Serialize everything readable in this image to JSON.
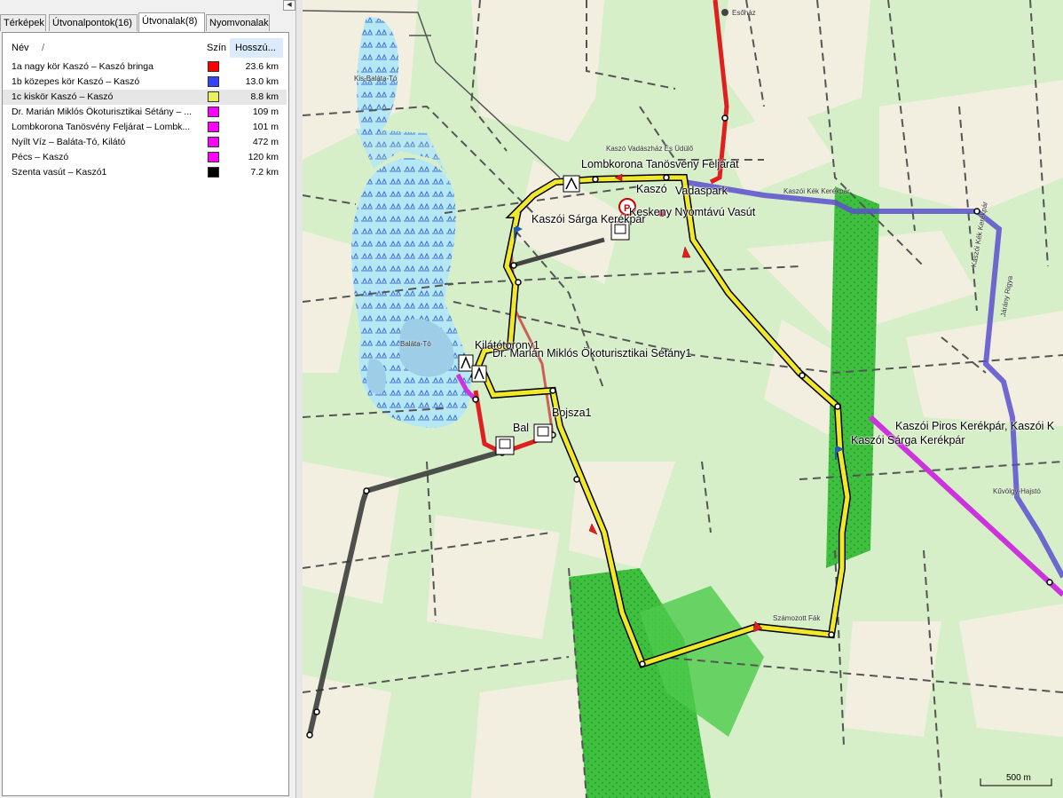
{
  "tabs": [
    "Térképek",
    "Útvonalpontok(16)",
    "Útvonalak(8)",
    "Nyomvonalak"
  ],
  "table": {
    "col_name": "Név",
    "col_sort": "/",
    "col_color": "Szín",
    "col_length": "Hosszú..."
  },
  "routes": [
    {
      "name": "1a nagy kör Kaszó – Kaszó bringa",
      "color": "#ff0000",
      "length": "23.6 km"
    },
    {
      "name": "1b közepes kör Kaszó – Kaszó",
      "color": "#3344ff",
      "length": "13.0 km"
    },
    {
      "name": "1c kiskör Kaszó – Kaszó",
      "color": "#e8f060",
      "length": "8.8 km"
    },
    {
      "name": "Dr. Marián Miklós Ökoturisztikai Sétány – ...",
      "color": "#ff00ff",
      "length": "109 m"
    },
    {
      "name": "Lombkorona Tanösvény Feljárat – Lombk...",
      "color": "#ff00ff",
      "length": "101 m"
    },
    {
      "name": "Nyílt Víz – Baláta-Tó, Kilátó",
      "color": "#ff00ff",
      "length": "472 m"
    },
    {
      "name": "Pécs – Kaszó",
      "color": "#ff00ff",
      "length": "120 km"
    },
    {
      "name": "Szenta vasút – Kaszó1",
      "color": "#000000",
      "length": "7.2 km"
    }
  ],
  "map": {
    "labels": {
      "lombkorona": "Lombkorona Tanösvény Feljárat",
      "kaszo": "Kaszó",
      "vadaspark": "Vadaspark",
      "sarga": "Kaszói Sárga Kerékpár",
      "keskeny": "Keskeny Nyomtávú Vasút",
      "kilatotorony": "Kilátótorony1",
      "marian": "Dr. Marián Miklós Ökoturisztikai Sétány1",
      "bojsza": "Bojsza1",
      "bal": "Bal",
      "piros": "Kaszói Piros Kerékpár, Kaszói K",
      "sarga2": "Kaszói Sárga Kerékpár"
    },
    "small": {
      "eshaz": "Esőház",
      "kisbalata": "Kis-Baláta-Tó",
      "balatato": "Baláta-Tó",
      "vadaszhaz": "Kaszó Vadászház És Üdülő",
      "kekkerekpar": "Kaszói Kék Kerékpár",
      "kekkerekpar2": "Kaszói Kék Kerékpár",
      "jarany": "Járány Rigya",
      "kuvolgy": "Kűvölgy-Hajstó",
      "szamozott": "Számozott Fák"
    },
    "scale": "500 m"
  }
}
